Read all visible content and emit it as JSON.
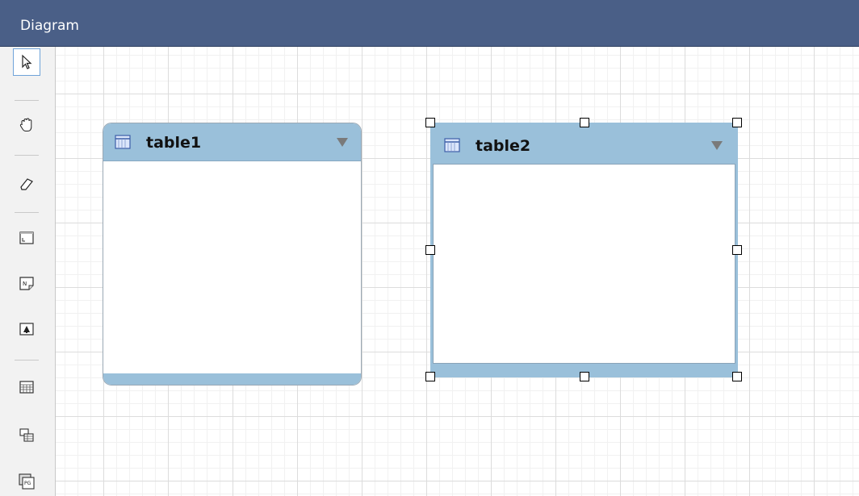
{
  "window": {
    "title": "Diagram"
  },
  "toolbar": {
    "tools": [
      {
        "name": "pointer",
        "icon": "pointer-icon",
        "active": true
      },
      {
        "name": "hand",
        "icon": "hand-icon"
      },
      {
        "name": "eraser",
        "icon": "eraser-icon"
      },
      {
        "name": "layer",
        "icon": "layer-icon"
      },
      {
        "name": "note",
        "icon": "note-icon"
      },
      {
        "name": "image",
        "icon": "image-icon"
      },
      {
        "name": "table",
        "icon": "table-icon"
      },
      {
        "name": "view",
        "icon": "view-icon"
      },
      {
        "name": "routine-group",
        "icon": "routine-group-icon"
      }
    ]
  },
  "canvas": {
    "tables": [
      {
        "name": "table1",
        "selected": false
      },
      {
        "name": "table2",
        "selected": true
      }
    ]
  },
  "colors": {
    "titlebar": "#4a5f87",
    "table_header": "#9ac0da",
    "selection_handle": "#000000"
  }
}
